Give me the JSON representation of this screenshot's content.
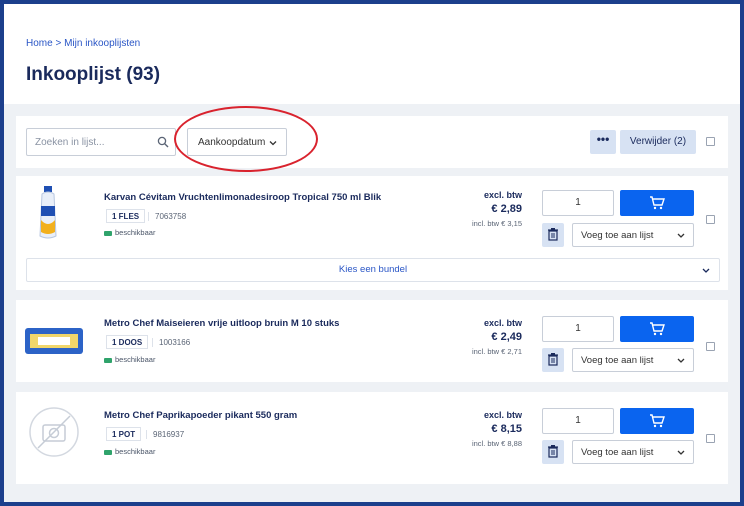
{
  "breadcrumb": {
    "home": "Home",
    "separator": ">",
    "current": "Mijn inkooplijsten"
  },
  "page_title": "Inkooplijst (93)",
  "toolbar": {
    "search_placeholder": "Zoeken in lijst...",
    "sort_value": "Aankoopdatum",
    "more_label": "•••",
    "remove_label": "Verwijder (2)"
  },
  "products": [
    {
      "name": "Karvan Cévitam Vruchtenlimonadesiroop Tropical 750 ml Blik",
      "pack": "1 FLES",
      "code": "7063758",
      "availability": "beschikbaar",
      "excl_label": "excl. btw",
      "price": "€ 2,89",
      "incl": "incl. btw € 3,15",
      "qty": "1",
      "add_to_list": "Voeg toe aan lijst",
      "bundle": "Kies een bundel"
    },
    {
      "name": "Metro Chef Maiseieren vrije uitloop bruin M 10 stuks",
      "pack": "1 DOOS",
      "code": "1003166",
      "availability": "beschikbaar",
      "excl_label": "excl. btw",
      "price": "€ 2,49",
      "incl": "incl. btw € 2,71",
      "qty": "1",
      "add_to_list": "Voeg toe aan lijst"
    },
    {
      "name": "Metro Chef Paprikapoeder pikant 550 gram",
      "pack": "1 POT",
      "code": "9816937",
      "availability": "beschikbaar",
      "excl_label": "excl. btw",
      "price": "€ 8,15",
      "incl": "incl. btw € 8,88",
      "qty": "1",
      "add_to_list": "Voeg toe aan lijst"
    }
  ],
  "colors": {
    "accent": "#0a64ef",
    "title": "#1a2a5c",
    "highlight_oval": "#d9232e",
    "available": "#2fa36b"
  }
}
